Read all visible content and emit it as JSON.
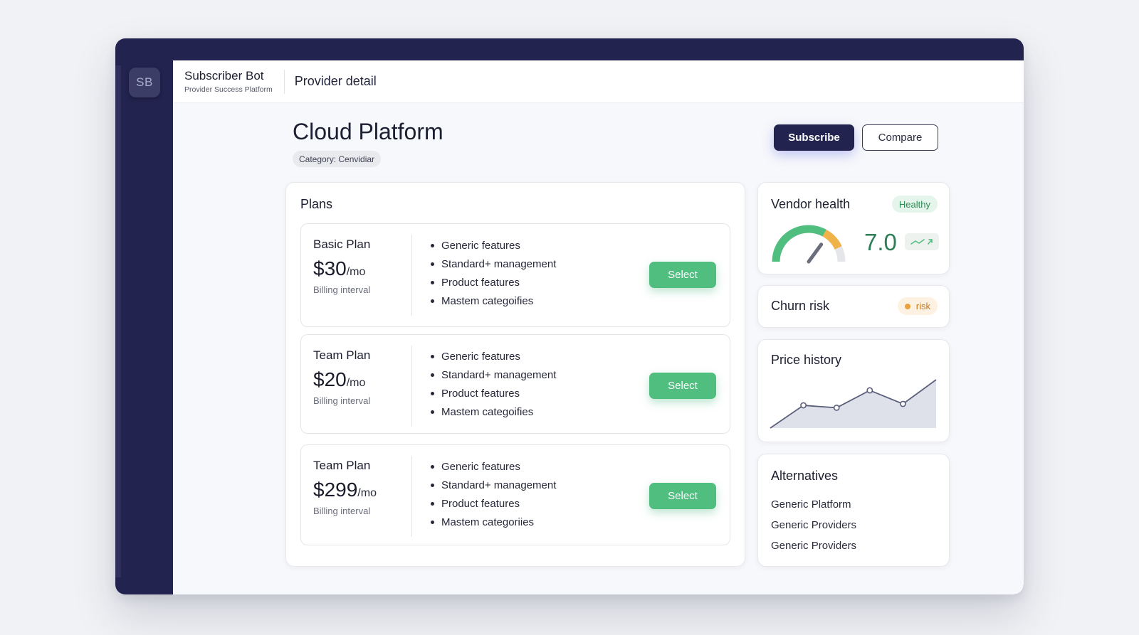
{
  "app": {
    "logo_initials": "SB",
    "brand_title": "Subscriber Bot",
    "brand_subtitle": "Provider Success Platform",
    "breadcrumb": "Provider detail"
  },
  "provider": {
    "title": "Cloud Platform",
    "category": "Category: Cenvidiar"
  },
  "actions": {
    "subscribe_label": "Subscribe",
    "compare_label": "Compare"
  },
  "plans": {
    "title": "Plans",
    "items": [
      {
        "name": "Basic Plan",
        "price": "$30",
        "per": "/mo",
        "interval": "Billing interval",
        "features": [
          "Generic features",
          "Standard+ management",
          "Product features",
          "Mastem categoifies"
        ],
        "select_label": "Select"
      },
      {
        "name": "Team Plan",
        "price": "$20",
        "per": "/mo",
        "interval": "Billing interval",
        "features": [
          "Generic features",
          "Standard+ management",
          "Product features",
          "Mastem categoifies"
        ],
        "select_label": "Select"
      },
      {
        "name": "Team Plan",
        "price": "$299",
        "per": "/mo",
        "interval": "Billing interval",
        "features": [
          "Generic features",
          "Standard+ management",
          "Product features",
          "Mastem categoriies"
        ],
        "select_label": "Select"
      }
    ]
  },
  "vendor_health": {
    "title": "Vendor health",
    "status": "Healthy",
    "score": "7.0",
    "gauge_fraction": 0.7,
    "trend_icon": "trend-up-icon",
    "colors": {
      "good": "#4fbe7f",
      "warn": "#f0b34a",
      "track": "#e4e6ea",
      "score": "#2d7d57"
    }
  },
  "churn_risk": {
    "title": "Churn risk",
    "status": "risk",
    "color": "#eaa13c"
  },
  "price_history": {
    "title": "Price history",
    "values": [
      0,
      0.47,
      0.42,
      0.78,
      0.5,
      1.0
    ]
  },
  "alternatives": {
    "title": "Alternatives",
    "items": [
      "Generic Platform",
      "Generic Providers",
      "Generic Providers"
    ]
  }
}
